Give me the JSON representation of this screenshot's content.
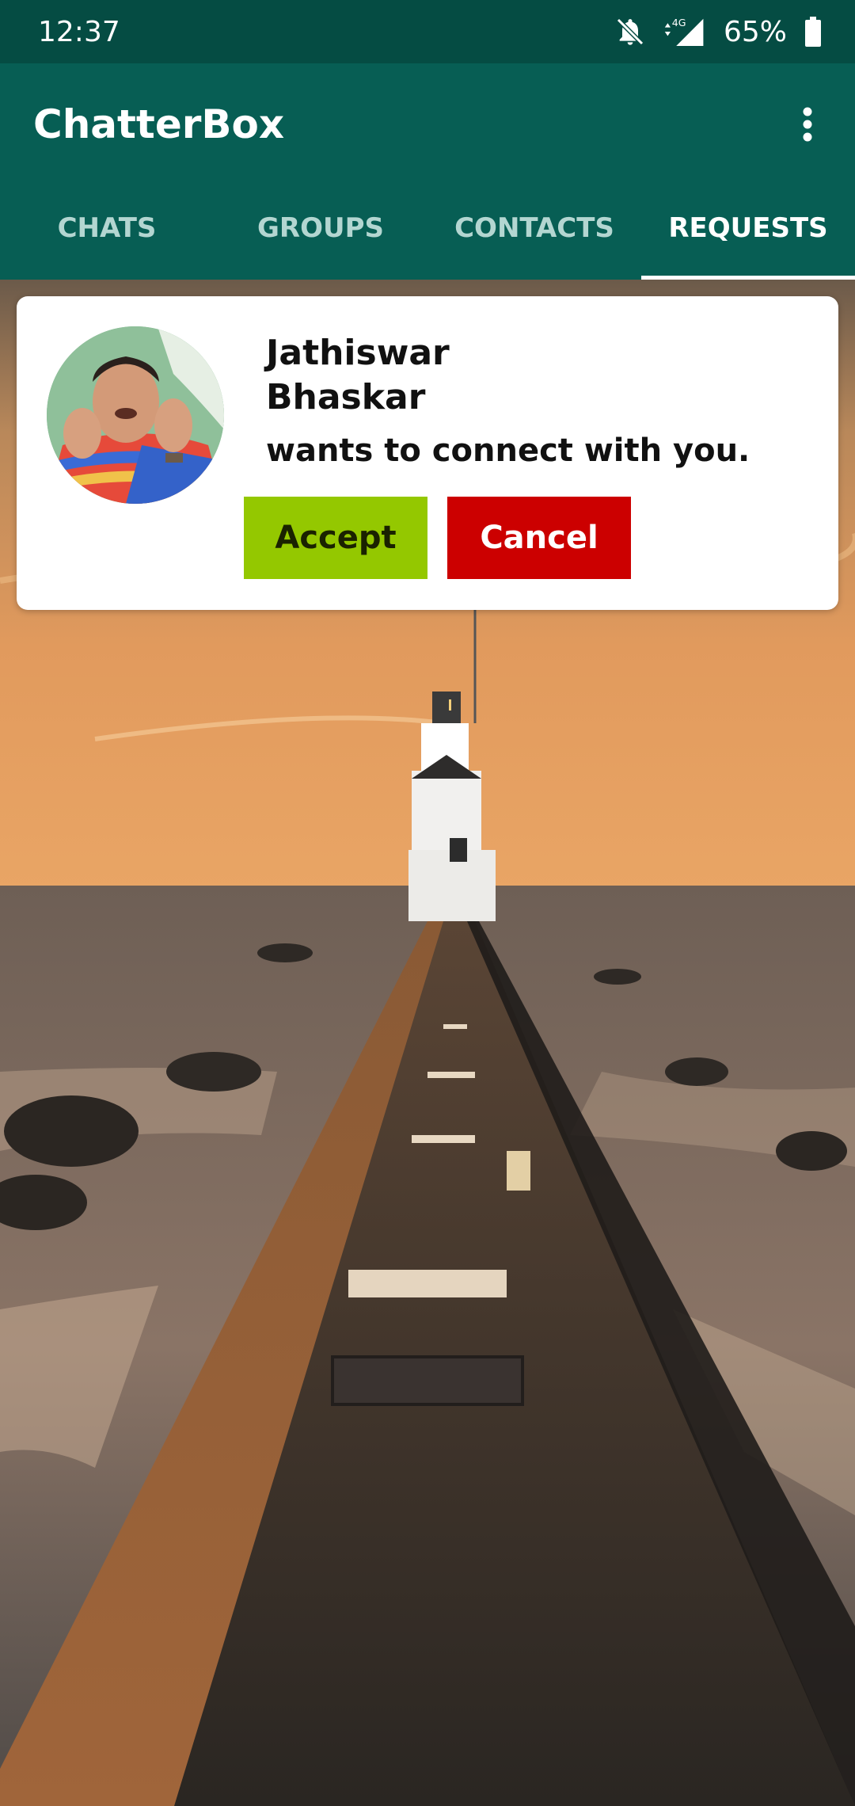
{
  "status_bar": {
    "time": "12:37",
    "network": "4G",
    "battery": "65%",
    "icons": [
      "bell-off-icon",
      "signal-icon",
      "battery-icon"
    ]
  },
  "app": {
    "title": "ChatterBox",
    "menu_icon": "more-vert-icon"
  },
  "tabs": [
    {
      "label": "CHATS",
      "active": false
    },
    {
      "label": "GROUPS",
      "active": false
    },
    {
      "label": "CONTACTS",
      "active": false
    },
    {
      "label": "REQUESTS",
      "active": true
    }
  ],
  "request": {
    "name_line1": "Jathiswar",
    "name_line2": "Bhaskar",
    "message": "wants to connect with you.",
    "accept_label": "Accept",
    "cancel_label": "Cancel"
  },
  "colors": {
    "primary": "#075e54",
    "status_bar": "#054c43",
    "accept": "#94c800",
    "cancel": "#cc0000",
    "card": "#ffffff"
  }
}
